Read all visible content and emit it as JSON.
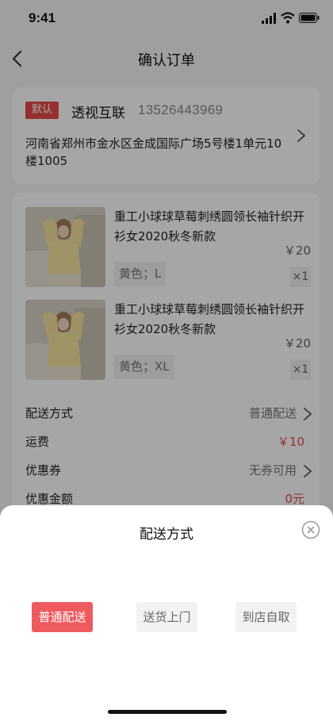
{
  "status_bar": {
    "time": "9:41"
  },
  "nav": {
    "title": "确认订单"
  },
  "address": {
    "tag": "默认",
    "name": "透视互联",
    "phone": "13526443969",
    "detail": "河南省郑州市金水区金成国际广场5号楼1单元10楼1005"
  },
  "products": [
    {
      "title": "重工小球球草莓刺绣圆领长袖针织开衫女2020秋冬新款",
      "price": "￥20",
      "spec": "黄色；L",
      "qty": "×1"
    },
    {
      "title": "重工小球球草莓刺绣圆领长袖针织开衫女2020秋冬新款",
      "price": "￥20",
      "spec": "黄色；XL",
      "qty": "×1"
    }
  ],
  "order_rows": {
    "delivery": {
      "label": "配送方式",
      "value": "普通配送"
    },
    "freight": {
      "label": "运费",
      "value": "￥10"
    },
    "coupon": {
      "label": "优惠券",
      "value": "无券可用"
    },
    "discount": {
      "label": "优惠金额",
      "value": "0元"
    }
  },
  "sheet": {
    "title": "配送方式",
    "options": [
      "普通配送",
      "送货上门",
      "到店自取"
    ],
    "selected": "普通配送"
  },
  "colors": {
    "accent": "#e74b4b",
    "selected_option": "#ee5b5f"
  },
  "icons": [
    "signal-icon",
    "wifi-icon",
    "battery-icon",
    "back-arrow-icon",
    "chevron-right-icon",
    "close-circle-icon"
  ]
}
